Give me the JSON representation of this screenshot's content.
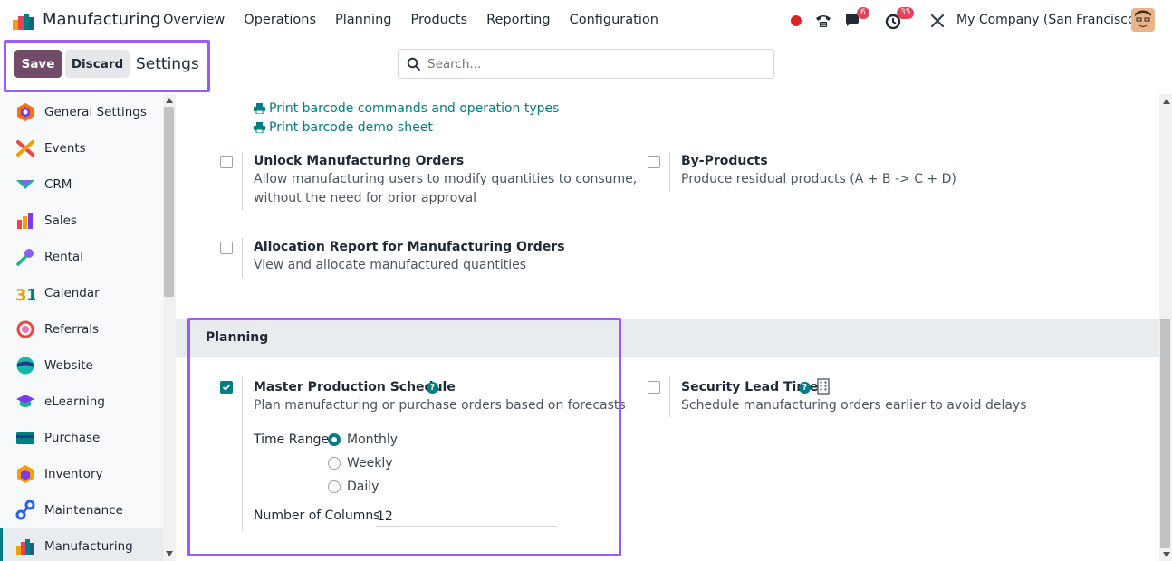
{
  "navbar": {
    "app_name": "Manufacturing",
    "menu": [
      "Overview",
      "Operations",
      "Planning",
      "Products",
      "Reporting",
      "Configuration"
    ],
    "messages_count": "6",
    "activities_count": "35",
    "company": "My Company (San Francisco)"
  },
  "control_panel": {
    "save_label": "Save",
    "discard_label": "Discard",
    "breadcrumb": "Settings",
    "search_placeholder": "Search..."
  },
  "sidebar": {
    "items": [
      {
        "label": "General Settings",
        "icon": "general-settings-icon"
      },
      {
        "label": "Events",
        "icon": "events-icon"
      },
      {
        "label": "CRM",
        "icon": "crm-icon"
      },
      {
        "label": "Sales",
        "icon": "sales-icon"
      },
      {
        "label": "Rental",
        "icon": "rental-icon"
      },
      {
        "label": "Calendar",
        "icon": "calendar-icon"
      },
      {
        "label": "Referrals",
        "icon": "referrals-icon"
      },
      {
        "label": "Website",
        "icon": "website-icon"
      },
      {
        "label": "eLearning",
        "icon": "elearning-icon"
      },
      {
        "label": "Purchase",
        "icon": "purchase-icon"
      },
      {
        "label": "Inventory",
        "icon": "inventory-icon"
      },
      {
        "label": "Maintenance",
        "icon": "maintenance-icon"
      },
      {
        "label": "Manufacturing",
        "icon": "manufacturing-icon",
        "active": true
      }
    ]
  },
  "content": {
    "links": [
      "Print barcode commands and operation types",
      "Print barcode demo sheet"
    ],
    "settings": {
      "unlock": {
        "title": "Unlock Manufacturing Orders",
        "desc_1": "Allow manufacturing users to modify quantities to consume,",
        "desc_2": "without the need for prior approval",
        "checked": false
      },
      "byproducts": {
        "title": "By-Products",
        "desc": "Produce residual products (A + B -> C + D)",
        "checked": false
      },
      "allocation": {
        "title": "Allocation Report for Manufacturing Orders",
        "desc": "View and allocate manufactured quantities",
        "checked": false
      }
    },
    "planning": {
      "section_title": "Planning",
      "mps": {
        "title": "Master Production Schedule",
        "desc": "Plan manufacturing or purchase orders based on forecasts",
        "checked": true
      },
      "time_range_label": "Time Range",
      "time_range_options": [
        "Monthly",
        "Weekly",
        "Daily"
      ],
      "time_range_selected": "Monthly",
      "columns_label": "Number of Columns",
      "columns_value": "12",
      "security": {
        "title": "Security Lead Time",
        "desc": "Schedule manufacturing orders earlier to avoid delays",
        "checked": false
      }
    }
  },
  "colors": {
    "brand": "#714b67",
    "accent": "#017e84",
    "highlight": "#9b5cf6"
  }
}
